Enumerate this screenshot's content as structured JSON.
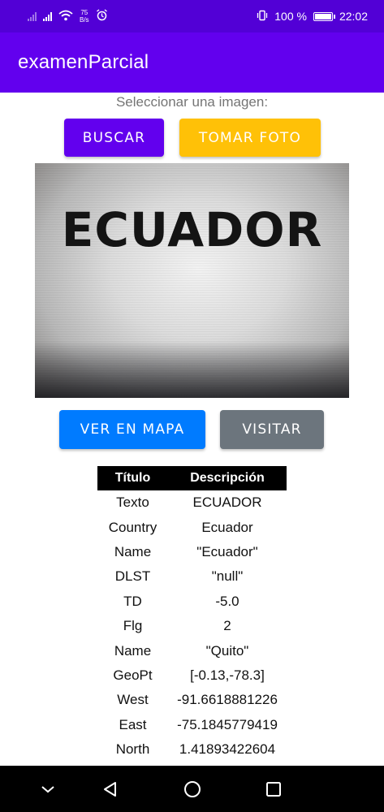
{
  "status_bar": {
    "net_speed_value": "75",
    "net_speed_unit": "B/s",
    "battery_percent": "100 %",
    "battery_level": 1.0,
    "time": "22:02"
  },
  "app_bar": {
    "title": "examenParcial"
  },
  "image_picker": {
    "label": "Seleccionar una imagen:",
    "buscar_label": "BUSCAR",
    "tomar_foto_label": "TOMAR FOTO"
  },
  "photo": {
    "text": "ECUADOR"
  },
  "actions": {
    "ver_en_mapa_label": "VER EN MAPA",
    "visitar_label": "VISITAR"
  },
  "table": {
    "headers": [
      "Título",
      "Descripción"
    ],
    "rows": [
      [
        "Texto",
        "ECUADOR"
      ],
      [
        "Country",
        "Ecuador"
      ],
      [
        "Name",
        "\"Ecuador\""
      ],
      [
        "DLST",
        "\"null\""
      ],
      [
        "TD",
        "-5.0"
      ],
      [
        "Flg",
        "2"
      ],
      [
        "Name",
        "\"Quito\""
      ],
      [
        "GeoPt",
        "[-0.13,-78.3]"
      ],
      [
        "West",
        "-91.6618881226"
      ],
      [
        "East",
        "-75.1845779419"
      ],
      [
        "North",
        "1.41893422604"
      ]
    ]
  },
  "colors": {
    "status_bar": "#5200d6",
    "app_bar": "#6200ee",
    "buscar": "#6200ee",
    "tomar_foto": "#ffc107",
    "ver_en_mapa": "#007bff",
    "visitar": "#6c757d"
  },
  "icons": {
    "status_left": [
      "signal-bars-icon",
      "signal-bars-icon",
      "wifi-icon",
      "alarm-icon"
    ],
    "status_right": [
      "vibrate-icon",
      "battery-icon"
    ],
    "nav": [
      "chevron-down-icon",
      "back-triangle-icon",
      "home-circle-icon",
      "recents-square-icon"
    ]
  }
}
